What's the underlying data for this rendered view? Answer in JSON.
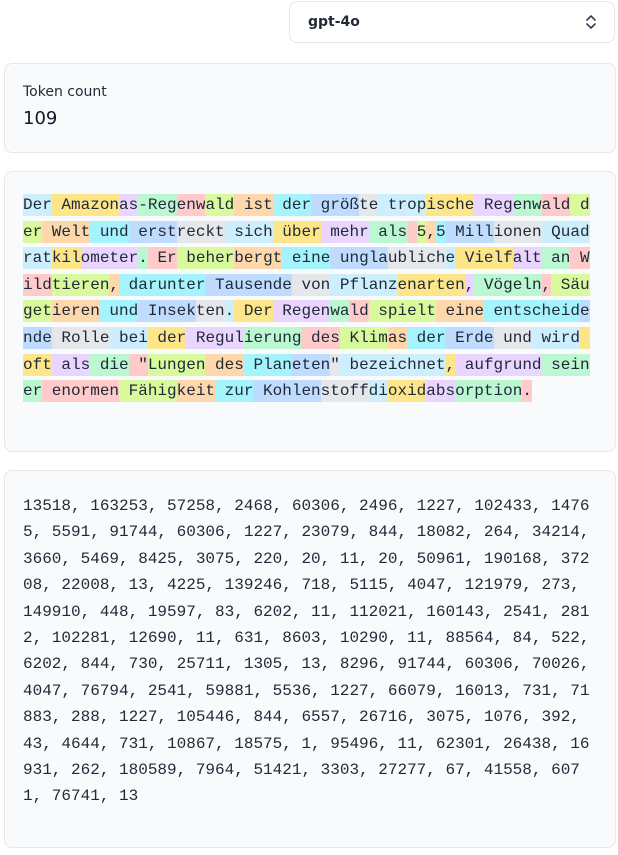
{
  "model_select": {
    "value": "gpt-4o",
    "icon": "chevron-up-down-icon"
  },
  "token_count": {
    "label": "Token count",
    "value": "109"
  },
  "token_colors": [
    "#cdeffd",
    "#fde68a",
    "#e9d5ff",
    "#bbf7d0",
    "#fecaca",
    "#d9f99d",
    "#fed7aa",
    "#a5f3fc",
    "#bfdbfe",
    "#e5e7eb"
  ],
  "tokens": [
    "Der",
    " Amazon",
    "as",
    "-Reg",
    "enw",
    "ald",
    " ist",
    " der",
    " größ",
    "te",
    " trop",
    "ische",
    " Reg",
    "enw",
    "ald",
    " der",
    " Welt",
    " und",
    " erst",
    "reckt",
    " sich",
    " über",
    " mehr",
    " als",
    " ",
    "5",
    ",",
    "5",
    " Mill",
    "ionen",
    " Quadrat",
    "kil",
    "ometer",
    ".",
    " Er",
    " beher",
    "bergt",
    " eine",
    " ungla",
    "ublich",
    "e",
    " Vielf",
    "alt",
    " an",
    " Wild",
    "tieren",
    ",",
    " darunter",
    " Tausende",
    " von",
    " Pflanz",
    "enarten",
    ",",
    " Vögeln",
    ",",
    " Säuget",
    "ieren",
    " und",
    " Insek",
    "ten",
    ".",
    " Der",
    " Regen",
    "wa",
    "ld",
    " spielt",
    " eine",
    " entscheid",
    "ende",
    " Rolle",
    " bei",
    " der",
    " Regul",
    "ierung",
    " des",
    " Klim",
    "as",
    " der",
    " Erde",
    " und",
    " wird",
    " oft",
    " als",
    " die",
    " \"",
    "Lungen",
    " des",
    " Plan",
    "eten",
    "\"",
    " bezeichnet",
    ",",
    " aufgrund",
    " seiner",
    " enormen",
    " Fähig",
    "keit",
    " zur",
    " Kohlen",
    "stoff",
    "di",
    "oxid",
    "abs",
    "orption",
    "."
  ],
  "token_ids": "13518, 163253, 57258, 2468, 60306, 2496, 1227, 102433, 14765, 5591, 91744, 60306, 1227, 23079, 844, 18082, 264, 34214, 3660, 5469, 8425, 3075, 220, 20, 11, 20, 50961, 190168, 37208, 22008, 13, 4225, 139246, 718, 5115, 4047, 121979, 273, 149910, 448, 19597, 83, 6202, 11, 112021, 160143, 2541, 2812, 102281, 12690, 11, 631, 8603, 10290, 11, 88564, 84, 522, 6202, 844, 730, 25711, 1305, 13, 8296, 91744, 60306, 70026, 4047, 76794, 2541, 59881, 5536, 1227, 66079, 16013, 731, 71883, 288, 1227, 105446, 844, 6557, 26716, 3075, 1076, 392, 43, 4644, 731, 10867, 18575, 1, 95496, 11, 62301, 26438, 16931, 262, 180589, 7964, 51421, 3303, 27277, 67, 41558, 6071, 76741, 13"
}
